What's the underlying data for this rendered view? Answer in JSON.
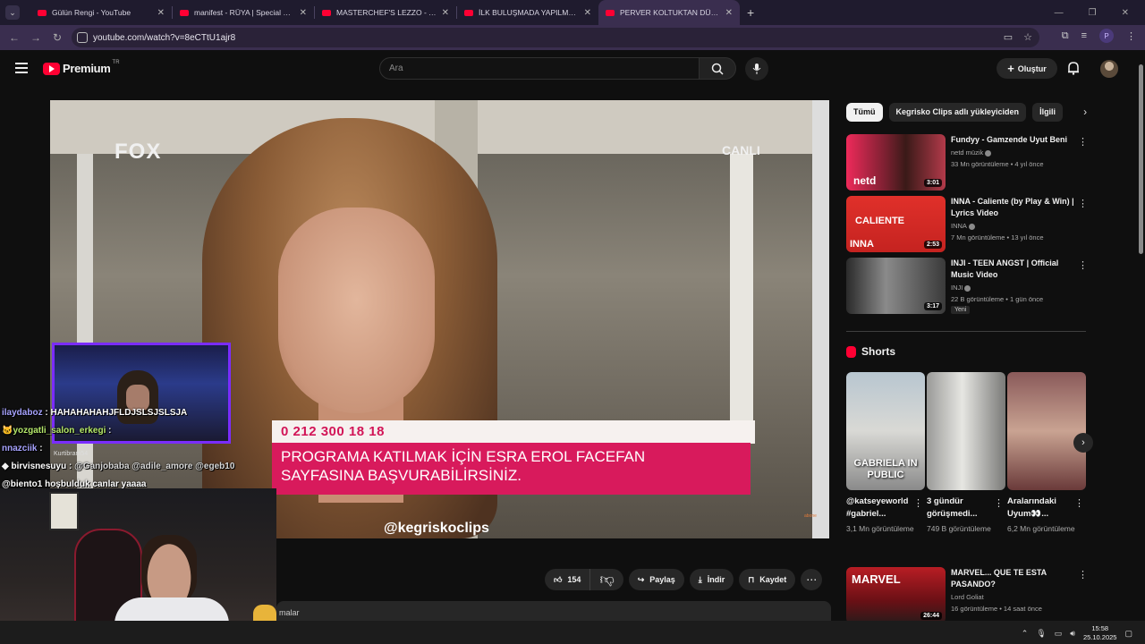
{
  "browser": {
    "tabs": [
      {
        "title": "Gülün Rengi - YouTube"
      },
      {
        "title": "manifest - RÜYA | Special Dance"
      },
      {
        "title": "MASTERCHEF'S LEZZO - YouTube"
      },
      {
        "title": "İLK BULUŞMADA YAPILMAMASI"
      },
      {
        "title": "PERVER KOLTUKTAN DÜŞÜYOR"
      }
    ],
    "url": "youtube.com/watch?v=8eCTtU1ajr8",
    "profile_initial": "P"
  },
  "youtube": {
    "logo_text": "Premium",
    "logo_region": "TR",
    "search_placeholder": "Ara",
    "create_label": "Oluştur"
  },
  "video_overlay": {
    "channel_logo": "FOX",
    "live_label": "CANLI",
    "phone": "0 212 300 18 18",
    "ticker_line1": "PROGRAMA KATILMAK İÇİN ESRA EROL FACEFAN",
    "ticker_line2": "SAYFASINA BAŞVURABİLİRSİNİZ.",
    "handle": "@kegriskoclips",
    "corner_mark": "abone"
  },
  "stream_chat": [
    {
      "user": "ilaydaboz",
      "msg": "HAHAHAHAHJFLDJSLSJSLSJA"
    },
    {
      "user": "yozgatli_salon_erkegi",
      "msg": ""
    },
    {
      "user": "nnazciik",
      "msg": ""
    },
    {
      "user": "birvisnesuyu",
      "msg": "@Ganjobaba @adile_amore @egeb10"
    },
    {
      "user": "",
      "msg": "@biento1 hoşbulduk canlar yaaaa"
    }
  ],
  "stream_overlay_text": "Kurtibram54",
  "actions": {
    "like_count": "154",
    "share_label": "Paylaş",
    "download_label": "İndir",
    "save_label": "Kaydet"
  },
  "description_fragment": "malar",
  "sidebar": {
    "chips": [
      "Tümü",
      "Kegrisko Clips adlı yükleyiciden",
      "İlgili"
    ],
    "recommendations": [
      {
        "title": "Fundyy - Gamzende Uyut Beni",
        "channel": "netd müzik",
        "meta": "33 Mn görüntüleme • 4 yıl önce",
        "duration": "3:01",
        "thumb_text": "netd"
      },
      {
        "title": "INNA - Caliente (by Play & Win) | Lyrics Video",
        "channel": "INNA",
        "meta": "7 Mn görüntüleme • 13 yıl önce",
        "duration": "2:53",
        "thumb_text": "CALIENTE"
      },
      {
        "title": "INJI - TEEN ANGST | Official Music Video",
        "channel": "INJI",
        "meta": "22 B görüntüleme • 1 gün önce",
        "duration": "3:17",
        "badge": "Yeni"
      },
      {
        "title": "MARVEL... QUE TE ESTA PASANDO?",
        "channel": "Lord Goliat",
        "meta": "16 görüntüleme • 14 saat önce",
        "duration": "26:44",
        "thumb_text": "MARVEL"
      }
    ],
    "shorts_heading": "Shorts",
    "shorts": [
      {
        "title": "@katseyeworld #gabriel...",
        "views": "3,1 Mn görüntüleme",
        "caption": "GABRIELA IN PUBLIC"
      },
      {
        "title": "3 gündür görüşmedi...",
        "views": "749 B görüntüleme",
        "caption": ""
      },
      {
        "title": "Aralarındaki Uyum👀...",
        "views": "6,2 Mn görüntüleme",
        "caption": ""
      }
    ]
  },
  "taskbar": {
    "time": "15:58",
    "date": "25.10.2025"
  },
  "colors": {
    "accent_red": "#ff0033",
    "ticker_pink": "#d81a5c",
    "webcam_border": "#7a2cff"
  }
}
